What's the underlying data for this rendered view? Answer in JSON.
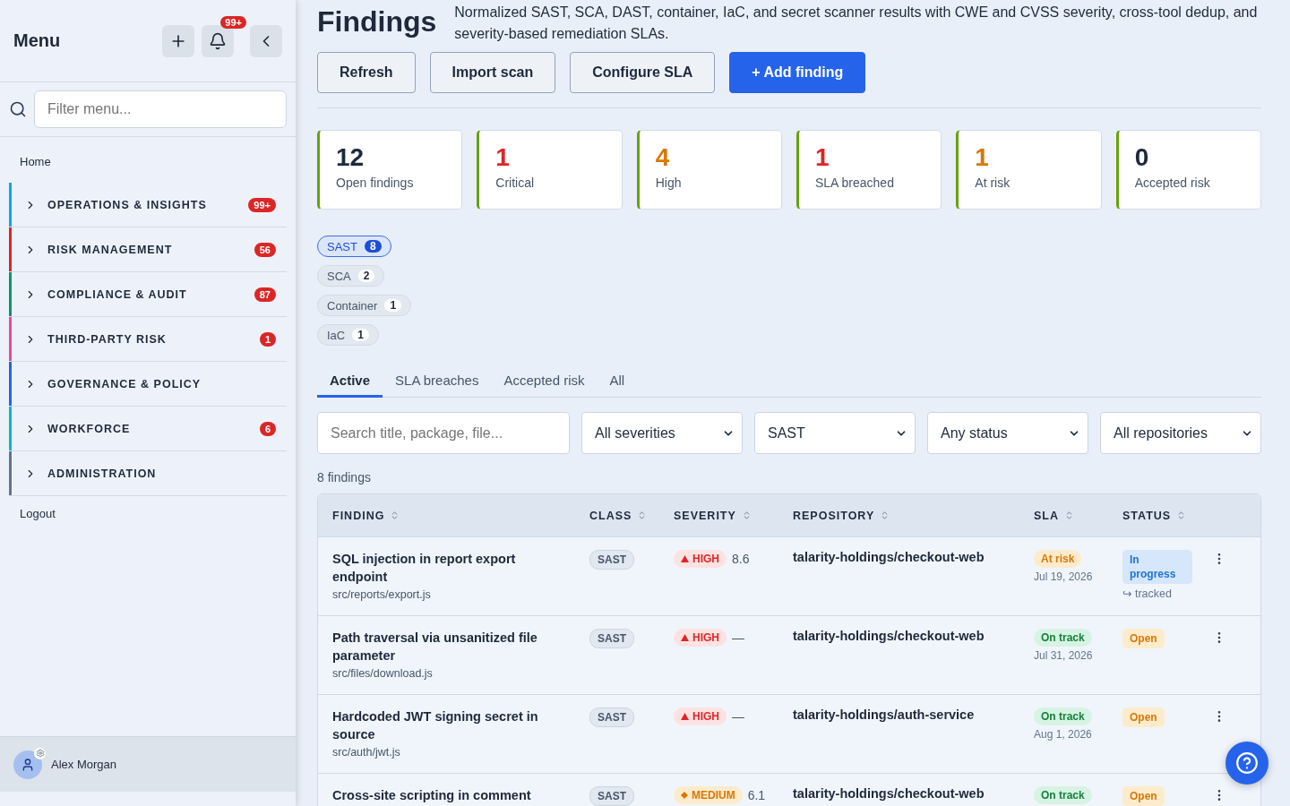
{
  "sidebar": {
    "title": "Menu",
    "notification_badge": "99+",
    "filter": {
      "placeholder": "Filter menu..."
    },
    "home": "Home",
    "sections": [
      {
        "label": "OPERATIONS & INSIGHTS",
        "badge": "99+",
        "color": "#0ea5e9"
      },
      {
        "label": "RISK MANAGEMENT",
        "badge": "56",
        "color": "#dc2626"
      },
      {
        "label": "COMPLIANCE & AUDIT",
        "badge": "87",
        "color": "#059669"
      },
      {
        "label": "THIRD-PARTY RISK",
        "badge": "1",
        "color": "#ec4899"
      },
      {
        "label": "GOVERNANCE & POLICY",
        "color": "#2563eb"
      },
      {
        "label": "WORKFORCE",
        "badge": "6",
        "color": "#06b6d4"
      },
      {
        "label": "ADMINISTRATION",
        "color": "#64748b"
      }
    ],
    "logout": "Logout",
    "user": "Alex Morgan"
  },
  "page": {
    "title": "Findings",
    "description": "Normalized SAST, SCA, DAST, container, IaC, and secret scanner results with CWE and CVSS severity, cross-tool dedup, and severity-based remediation SLAs.",
    "buttons": [
      {
        "label": "Refresh",
        "kind": "secondary"
      },
      {
        "label": "Import scan",
        "kind": "secondary"
      },
      {
        "label": "Configure SLA",
        "kind": "secondary"
      },
      {
        "label": "+ Add finding",
        "kind": "primary"
      }
    ]
  },
  "stats": [
    {
      "value": "12",
      "label": "Open findings",
      "color": "#1e293b"
    },
    {
      "value": "1",
      "label": "Critical",
      "color": "#dc2626"
    },
    {
      "value": "4",
      "label": "High",
      "color": "#d97706"
    },
    {
      "value": "1",
      "label": "SLA breached",
      "color": "#dc2626"
    },
    {
      "value": "1",
      "label": "At risk",
      "color": "#d97706"
    },
    {
      "value": "0",
      "label": "Accepted risk",
      "color": "#1e293b"
    }
  ],
  "class_chips": [
    {
      "label": "SAST",
      "count": "8",
      "selected": true
    },
    {
      "label": "SCA",
      "count": "2",
      "selected": false
    },
    {
      "label": "Container",
      "count": "1",
      "selected": false
    },
    {
      "label": "IaC",
      "count": "1",
      "selected": false
    }
  ],
  "tabs": [
    {
      "label": "Active",
      "selected": true
    },
    {
      "label": "SLA breaches",
      "selected": false
    },
    {
      "label": "Accepted risk",
      "selected": false
    },
    {
      "label": "All",
      "selected": false
    }
  ],
  "filters": {
    "search": {
      "placeholder": "Search title, package, file..."
    },
    "selects": [
      "All severities",
      "SAST",
      "Any status",
      "All repositories"
    ]
  },
  "result_count": "8 findings",
  "table": {
    "columns": [
      "FINDING",
      "CLASS",
      "SEVERITY",
      "REPOSITORY",
      "SLA",
      "STATUS"
    ],
    "rows": [
      {
        "title": "SQL injection in report export endpoint",
        "path": "src/reports/export.js",
        "class": "SAST",
        "severity": {
          "kind": "high",
          "label": "HIGH"
        },
        "score": "8.6",
        "repository": "talarity-holdings/checkout-web",
        "sla": {
          "kind": "at_risk",
          "label": "At risk",
          "date": "Jul 19, 2026"
        },
        "status": {
          "kind": "in_progress",
          "label": "In progress",
          "note": "↪ tracked"
        }
      },
      {
        "title": "Path traversal via unsanitized file parameter",
        "path": "src/files/download.js",
        "class": "SAST",
        "severity": {
          "kind": "high",
          "label": "HIGH"
        },
        "score": "—",
        "repository": "talarity-holdings/checkout-web",
        "sla": {
          "kind": "on_track",
          "label": "On track",
          "date": "Jul 31, 2026"
        },
        "status": {
          "kind": "open",
          "label": "Open"
        }
      },
      {
        "title": "Hardcoded JWT signing secret in source",
        "path": "src/auth/jwt.js",
        "class": "SAST",
        "severity": {
          "kind": "high",
          "label": "HIGH"
        },
        "score": "—",
        "repository": "talarity-holdings/auth-service",
        "sla": {
          "kind": "on_track",
          "label": "On track",
          "date": "Aug 1, 2026"
        },
        "status": {
          "kind": "open",
          "label": "Open"
        }
      },
      {
        "title": "Cross-site scripting in comment",
        "class": "SAST",
        "severity": {
          "kind": "medium",
          "label": "MEDIUM"
        },
        "score": "6.1",
        "repository": "talarity-holdings/checkout-web",
        "sla": {
          "kind": "on_track",
          "label": "On track"
        },
        "status": {
          "kind": "open",
          "label": "Open"
        }
      }
    ]
  }
}
